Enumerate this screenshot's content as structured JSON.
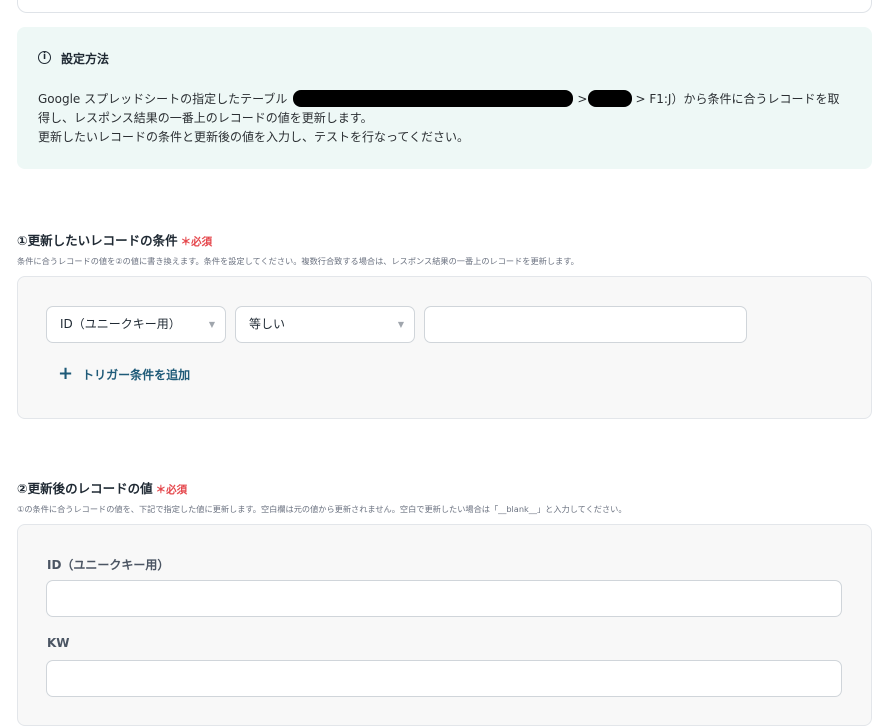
{
  "info": {
    "icon": "info-circle-icon",
    "title": "設定方法",
    "line1_pre": "Google スプレッドシートの指定したテーブル",
    "line1_sep": ">",
    "line1_post": "> F1:J）から条件に合うレコードを取",
    "line2": "得し、レスポンス結果の一番上のレコードの値を更新します。",
    "line3": "更新したいレコードの条件と更新後の値を入力し、テストを行なってください。"
  },
  "condition_section": {
    "title": "①更新したいレコードの条件",
    "required": "＊必須",
    "description": "条件に合うレコードの値を②の値に書き換えます。条件を設定してください。複数行合致する場合は、レスポンス結果の一番上のレコードを更新します。",
    "field_select": "ID（ユニークキー用）",
    "operator_select": "等しい",
    "value_input": "",
    "add_trigger_label": "トリガー条件を追加"
  },
  "value_section": {
    "title": "②更新後のレコードの値",
    "required": "＊必須",
    "description": "①の条件に合うレコードの値を、下記で指定した値に更新します。空白欄は元の値から更新されません。空白で更新したい場合は「__blank__」と入力してください。",
    "fields": [
      {
        "label": "ID（ユニークキー用）",
        "value": ""
      },
      {
        "label": "KW",
        "value": ""
      }
    ]
  },
  "colors": {
    "required": "#e5484d",
    "link": "#1e5a78",
    "info_bg": "#eef8f6"
  }
}
